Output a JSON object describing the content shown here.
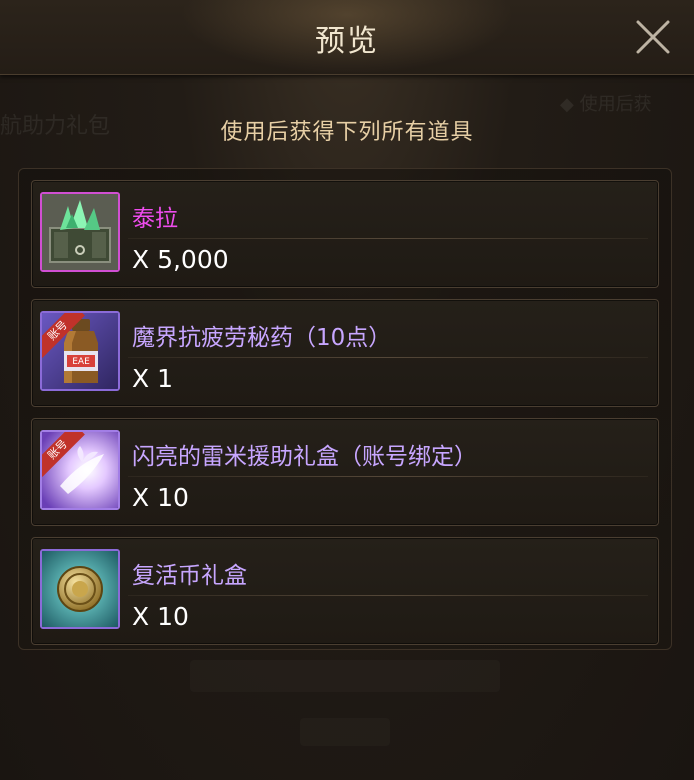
{
  "dialog": {
    "title": "预览",
    "subtitle": "使用后获得下列所有道具"
  },
  "colors": {
    "name_pink": "#ee4cee",
    "name_purple": "#c7a6ff",
    "title": "#f1e6cf",
    "subtitle": "#e7cfa5"
  },
  "items": [
    {
      "name": "泰拉",
      "quantity": "X 5,000",
      "icon": "tera-crystal-chest-icon",
      "badge": "",
      "name_color": "#ee4cee"
    },
    {
      "name": "魔界抗疲劳秘药（10点）",
      "quantity": "X 1",
      "icon": "fatigue-potion-icon",
      "badge": "账号",
      "name_color": "#c7a6ff"
    },
    {
      "name": "闪亮的雷米援助礼盒（账号绑定）",
      "quantity": "X 10",
      "icon": "gift-box-glow-icon",
      "badge": "账号",
      "name_color": "#c7a6ff"
    },
    {
      "name": "复活币礼盒",
      "quantity": "X 10",
      "icon": "revive-coin-icon",
      "badge": "",
      "name_color": "#c7a6ff"
    }
  ]
}
